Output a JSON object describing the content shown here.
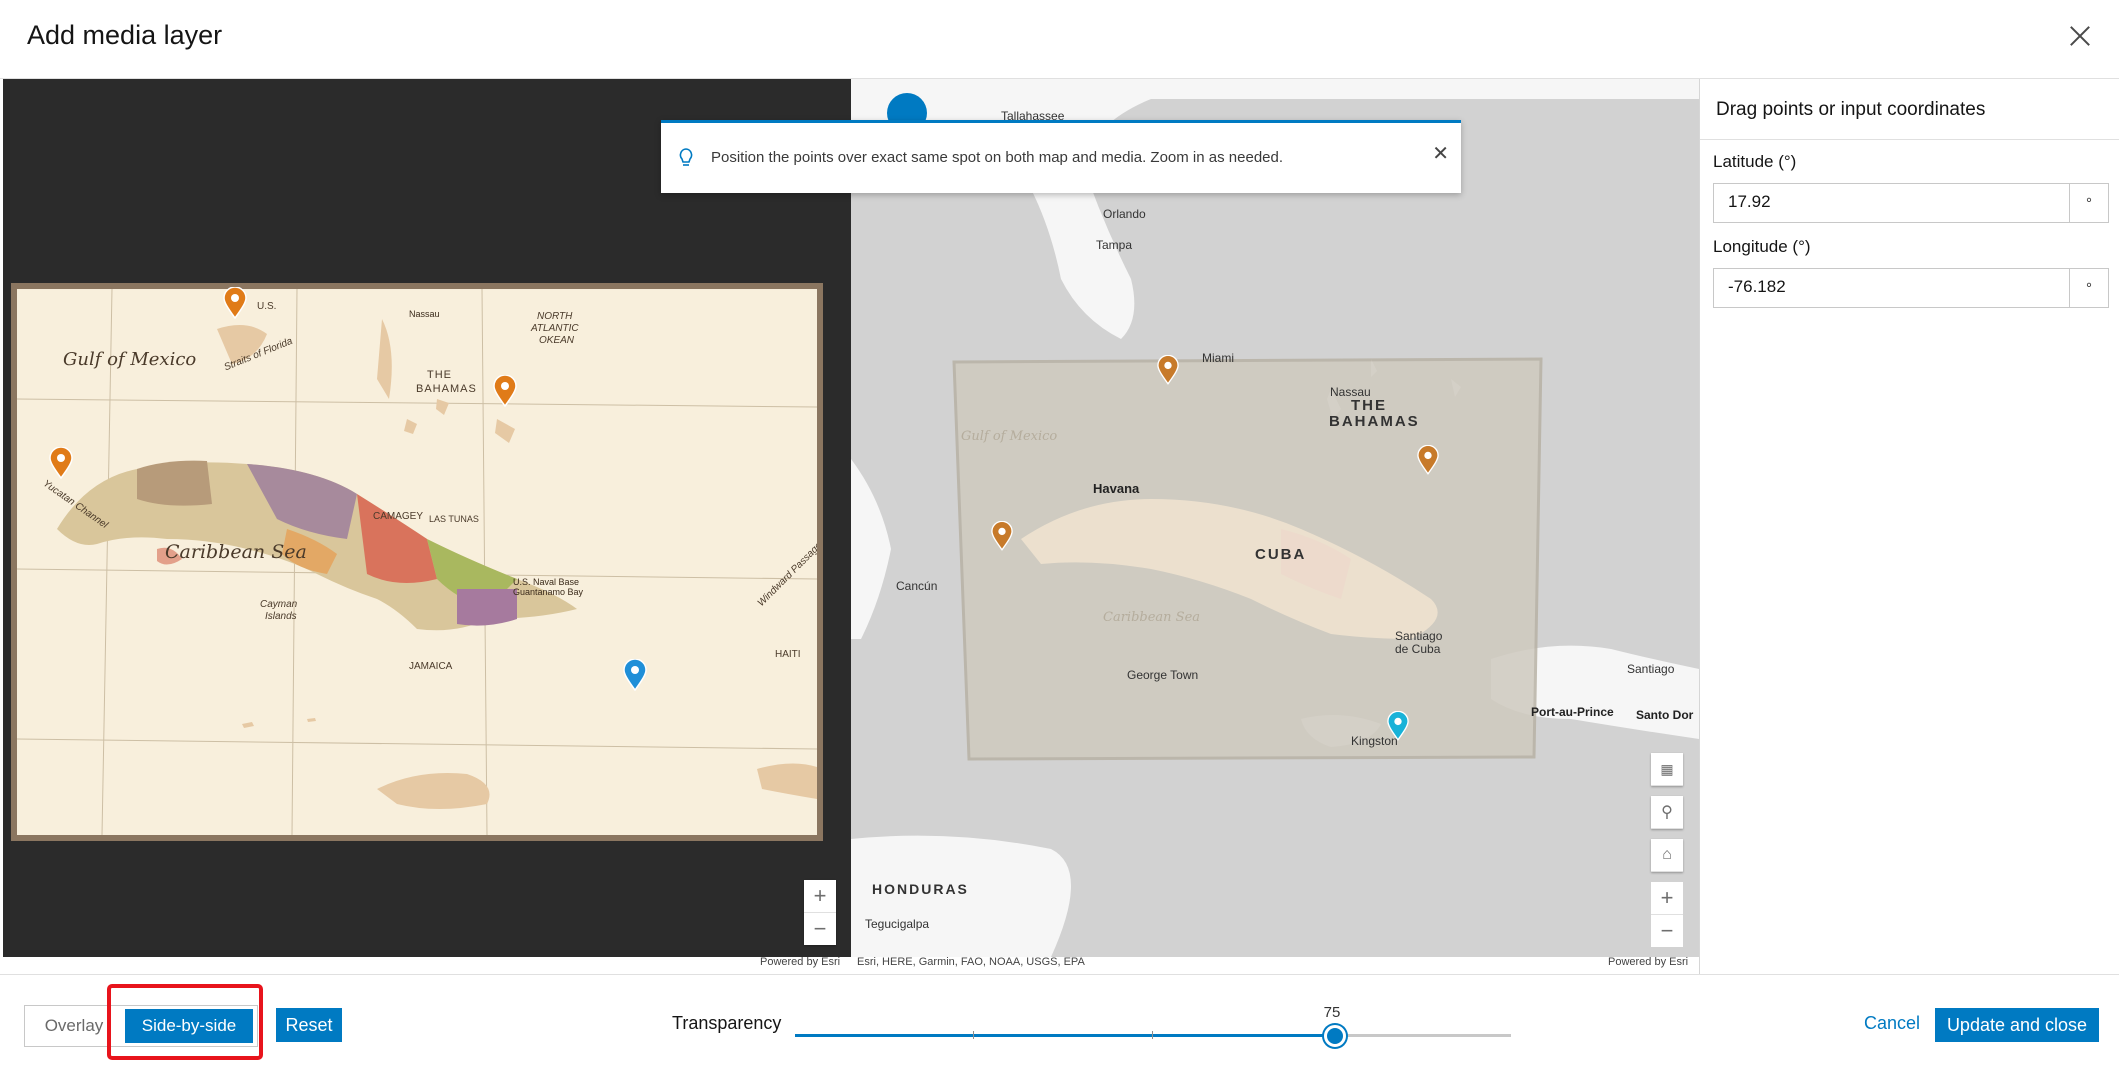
{
  "dialog": {
    "title": "Add media layer"
  },
  "notice": {
    "text": "Position the points over exact same spot on both map and media. Zoom in as needed."
  },
  "media_map": {
    "labels": [
      "Gulf of Mexico",
      "Caribbean Sea",
      "THE",
      "BAHAMAS",
      "NORTH",
      "ATLANTIC",
      "OKEAN",
      "JAMAICA",
      "HAITI",
      "CAMAGEY",
      "LAS TUNAS",
      "Cayman",
      "Islands",
      "Yucatan Channel",
      "Straits of Florida",
      "Windward Passage",
      "U.S.",
      "U.S. Naval Base",
      "Guantanamo Bay",
      "Nassau"
    ]
  },
  "basemap": {
    "labels": {
      "tallahassee": "Tallahassee",
      "orlando": "Orlando",
      "tampa": "Tampa",
      "miami": "Miami",
      "nassau": "Nassau",
      "the": "THE",
      "bahamas": "BAHAMAS",
      "havana": "Havana",
      "cuba": "CUBA",
      "cancun": "Cancún",
      "george_town": "George Town",
      "santiago_de": "Santiago",
      "de_cuba": "de Cuba",
      "santiago": "Santiago",
      "port_au_prince": "Port-au-Prince",
      "santo_dom": "Santo Dor",
      "kingston": "Kingston",
      "honduras": "HONDURAS",
      "tegucigalpa": "Tegucigalpa",
      "gulf": "Gulf of Mexico",
      "caribbean": "Caribbean Sea"
    }
  },
  "attribution": {
    "left": "Powered by Esri",
    "middle": "Esri, HERE, Garmin, FAO, NOAA, USGS, EPA",
    "right": "Powered by Esri"
  },
  "panel": {
    "heading": "Drag points or input coordinates",
    "latitude_label": "Latitude (°)",
    "latitude_value": "17.92",
    "longitude_label": "Longitude (°)",
    "longitude_value": "-76.182",
    "unit": "°"
  },
  "footer": {
    "overlay_label": "Overlay",
    "side_by_side_label": "Side-by-side",
    "reset_label": "Reset",
    "transparency_label": "Transparency",
    "transparency_value": 75,
    "transparency_value_text": "75",
    "cancel_label": "Cancel",
    "update_label": "Update and close"
  },
  "colors": {
    "accent": "#007ac2",
    "highlight": "#e8141c",
    "pin_orange": "#e07b18",
    "pin_blue": "#1f8fd8"
  }
}
